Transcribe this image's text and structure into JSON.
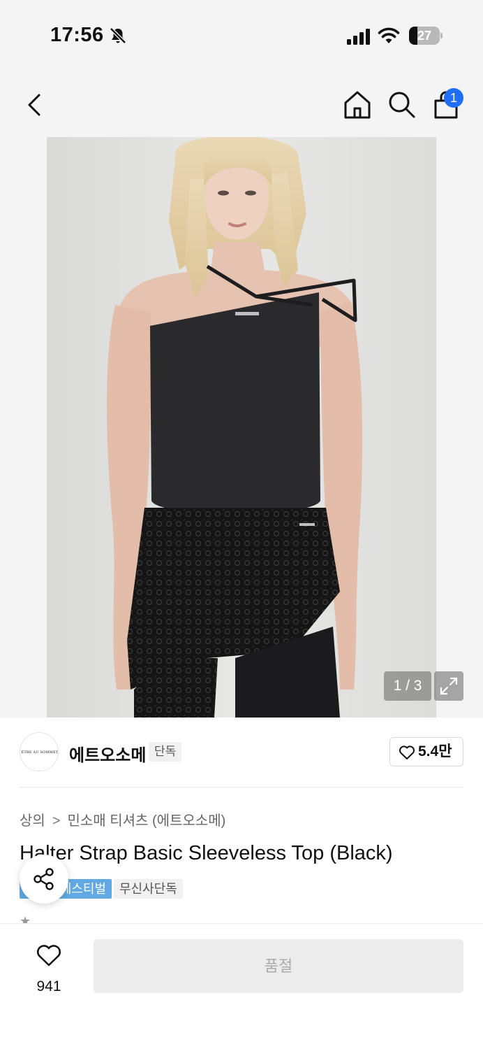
{
  "status_bar": {
    "time": "17:56",
    "battery_level": "27"
  },
  "header": {
    "cart_count": "1"
  },
  "gallery": {
    "page_indicator": "1 / 3"
  },
  "brand": {
    "logo_text": "ÊTRE AU SOMMET",
    "name": "에트오소메",
    "exclusive_tag": "단독",
    "like_count": "5.4만"
  },
  "breadcrumb": {
    "category": "상의",
    "separator": ">",
    "subcategory": "민소매 티셔츠 (에트오소메)"
  },
  "product": {
    "title": "Halter Strap Basic Sleeveless Top (Black)"
  },
  "promo_tags": {
    "festival": "페스티벌",
    "exclusive": "무신사단독"
  },
  "bottom_bar": {
    "wishlist_count": "941",
    "soldout_label": "품절"
  },
  "colors": {
    "accent_blue": "#1f6ef5",
    "festival_tag": "#62a9e3",
    "soldout_bg": "#ececec"
  }
}
